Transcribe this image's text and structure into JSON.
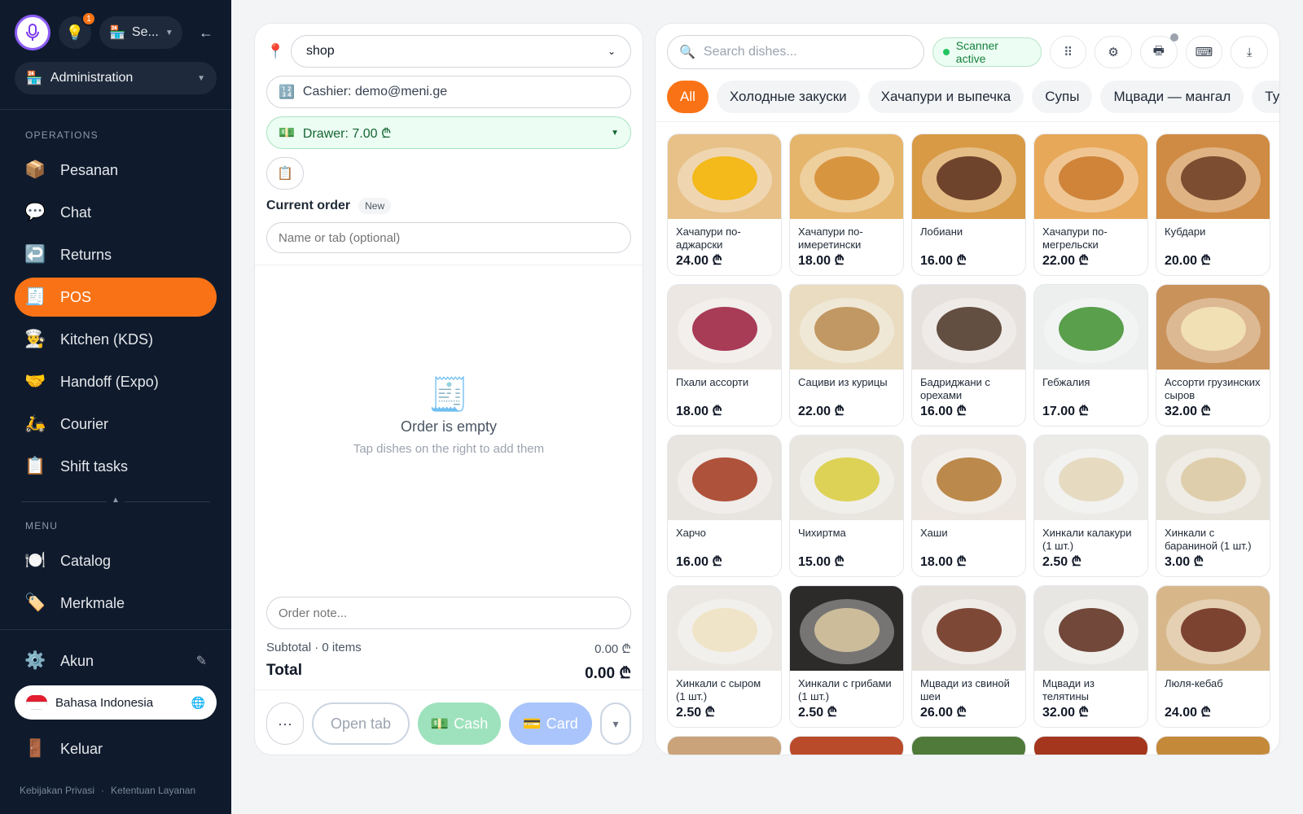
{
  "sidebar": {
    "store_label": "Se...",
    "badge_count": "1",
    "role_select": "Administration",
    "sections": [
      {
        "label": "OPERATIONS",
        "items": [
          {
            "label": "Pesanan",
            "icon": "📦"
          },
          {
            "label": "Chat",
            "icon": "💬"
          },
          {
            "label": "Returns",
            "icon": "↩️"
          },
          {
            "label": "POS",
            "icon": "🧾",
            "active": true
          },
          {
            "label": "Kitchen (KDS)",
            "icon": "👨‍🍳"
          },
          {
            "label": "Handoff (Expo)",
            "icon": "🤝"
          },
          {
            "label": "Courier",
            "icon": "🛵"
          },
          {
            "label": "Shift tasks",
            "icon": "📋"
          }
        ]
      },
      {
        "label": "MENU",
        "items": [
          {
            "label": "Catalog",
            "icon": "🍽️"
          },
          {
            "label": "Merkmale",
            "icon": "🏷️"
          }
        ]
      }
    ],
    "account_label": "Akun",
    "language_label": "Bahasa Indonesia",
    "logout_label": "Keluar",
    "footer_privacy": "Kebijakan Privasi",
    "footer_sep": "·",
    "footer_terms": "Ketentuan Layanan"
  },
  "order": {
    "location_value": "shop",
    "cashier": "Cashier: demo@meni.ge",
    "drawer": "Drawer: 7.00 ₾",
    "current_order_label": "Current order",
    "status_tag": "New",
    "name_placeholder": "Name or tab (optional)",
    "empty_title": "Order is empty",
    "empty_subtitle": "Tap dishes on the right to add them",
    "note_placeholder": "Order note...",
    "subtotal_label": "Subtotal · 0 items",
    "subtotal_value": "0.00 ₾",
    "total_label": "Total",
    "total_value": "0.00 ₾",
    "more_label": "···",
    "open_tab_label": "Open tab",
    "cash_label": "Cash",
    "card_label": "Card",
    "caret_label": "▾"
  },
  "menu": {
    "search_placeholder": "Search dishes...",
    "scanner_label": "Scanner active",
    "categories": [
      "All",
      "Холодные закуски",
      "Хачапури и выпечка",
      "Супы",
      "Мцвади — мангал",
      "Тушё"
    ],
    "dishes": [
      {
        "name": "Хачапури по-аджарски",
        "price": "24.00 ₾",
        "bg": "#e7c188",
        "accent": "#f5b400"
      },
      {
        "name": "Хачапури по-имеретински",
        "price": "18.00 ₾",
        "bg": "#e5b56b",
        "accent": "#d38b2f"
      },
      {
        "name": "Лобиани",
        "price": "16.00 ₾",
        "bg": "#d89a45",
        "accent": "#5a2f1c"
      },
      {
        "name": "Хачапури по-мегрельски",
        "price": "22.00 ₾",
        "bg": "#e7a85a",
        "accent": "#c9782a"
      },
      {
        "name": "Кубдари",
        "price": "20.00 ₾",
        "bg": "#cf8b43",
        "accent": "#6b3b22"
      },
      {
        "name": "Пхали ассорти",
        "price": "18.00 ₾",
        "bg": "#ece7e2",
        "accent": "#9b1b3b"
      },
      {
        "name": "Сациви из курицы",
        "price": "22.00 ₾",
        "bg": "#e9dcc1",
        "accent": "#b98a4f"
      },
      {
        "name": "Бадриджани с орехами",
        "price": "16.00 ₾",
        "bg": "#e6e1dc",
        "accent": "#4a3324"
      },
      {
        "name": "Гебжалия",
        "price": "17.00 ₾",
        "bg": "#ecefee",
        "accent": "#3f8f2e"
      },
      {
        "name": "Ассорти грузинских сыров",
        "price": "32.00 ₾",
        "bg": "#c9925a",
        "accent": "#f3e6b8"
      },
      {
        "name": "Харчо",
        "price": "16.00 ₾",
        "bg": "#e8e4df",
        "accent": "#a3361c"
      },
      {
        "name": "Чихиртма",
        "price": "15.00 ₾",
        "bg": "#e9e6df",
        "accent": "#d9cc3b"
      },
      {
        "name": "Хаши",
        "price": "18.00 ₾",
        "bg": "#ece7e0",
        "accent": "#b2772f"
      },
      {
        "name": "Хинкали калакури (1 шт.)",
        "price": "2.50 ₾",
        "bg": "#ecebe8",
        "accent": "#e4d6b8"
      },
      {
        "name": "Хинкали с бараниной (1 шт.)",
        "price": "3.00 ₾",
        "bg": "#e6e2d8",
        "accent": "#dcc9a1"
      },
      {
        "name": "Хинкали с сыром (1 шт.)",
        "price": "2.50 ₾",
        "bg": "#ebe8e3",
        "accent": "#efe2c0"
      },
      {
        "name": "Хинкали с грибами (1 шт.)",
        "price": "2.50 ₾",
        "bg": "#2d2b2a",
        "accent": "#dcc9a1"
      },
      {
        "name": "Мцвади из свиной шеи",
        "price": "26.00 ₾",
        "bg": "#e6e0db",
        "accent": "#6a2b18"
      },
      {
        "name": "Мцвади из телятины",
        "price": "32.00 ₾",
        "bg": "#e8e6e2",
        "accent": "#5b2a1a"
      },
      {
        "name": "Люля-кебаб",
        "price": "24.00 ₾",
        "bg": "#d7b78a",
        "accent": "#6b2a1a"
      }
    ],
    "peek_colors": [
      "#caa37a",
      "#b94a2a",
      "#4f7a3a",
      "#a3361c",
      "#c48a3a"
    ]
  },
  "colors": {
    "accent": "#f97316",
    "sidebar_bg": "#0f1b2d"
  }
}
